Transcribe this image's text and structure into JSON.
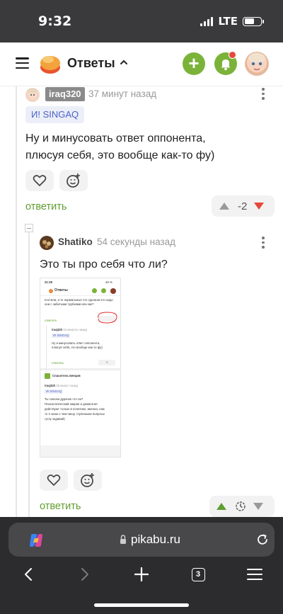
{
  "status_bar": {
    "time": "9:32",
    "network": "LTE"
  },
  "header": {
    "title": "Ответы",
    "accent": "#7bb33a"
  },
  "comment1": {
    "username": "iraq320",
    "time": "37 минут назад",
    "tag": "И! SINGAQ",
    "text_line1": "Ну и минусовать ответ оппонента,",
    "text_line2": "плюсуя себя, это вообще как-то фу)",
    "reply": "ответить",
    "rating": "-2"
  },
  "comment2": {
    "username": "Shatiko",
    "time": "54 секунды назад",
    "text": "Это ты про себя что ли?",
    "reply": "ответить"
  },
  "embedded": {
    "time": "21:29",
    "battery": "49 %",
    "header_title": "Ответы",
    "line_a": "постили, а те нормальные что сделали кто надо",
    "line_b": "они с забитыми трубками или как?",
    "reply1": "ответить",
    "c1_user": "iraq320",
    "c1_time": "34 минуты назад",
    "c1_tag": "И! SINGAQ",
    "c1_line1": "Ну и минусовать ответ оппонента,",
    "c1_line2": "плюсуя себя, это вообще как-то фу)",
    "reply2": "ответить",
    "c1_rating": "0",
    "section": "Спаситель венцов",
    "c2_user": "iraq320",
    "c2_time": "35 минут назад",
    "c2_tag": "И! SINGAQ",
    "c2_l1": "Ты совсем дурачок что ли?",
    "c2_l2": "Психологический накрап и демагогия",
    "c2_l3": "действуют только в политике, милага, сам",
    "c2_l4": "то я знаю о чем пишу, глупенькие вопросы",
    "c2_l5": "гуглу задавай)"
  },
  "browser": {
    "url": "pikabu.ru",
    "tab_count": "3"
  }
}
